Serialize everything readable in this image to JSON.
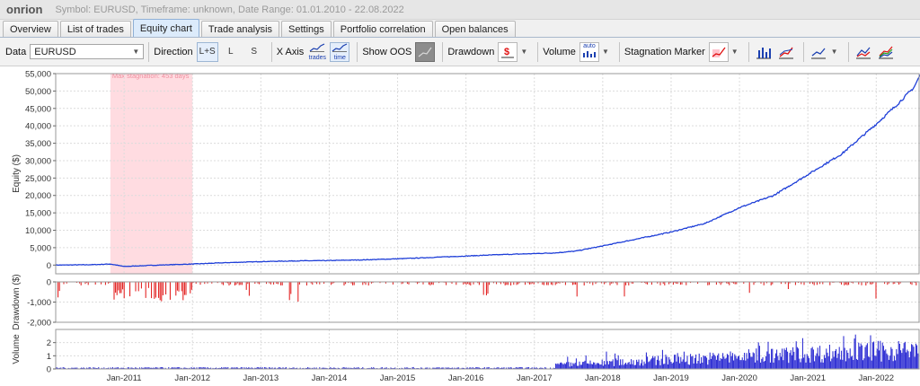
{
  "window": {
    "app_name": "onrion",
    "info": "Symbol: EURUSD, Timeframe: unknown, Date Range: 01.01.2010 - 22.08.2022"
  },
  "tabs": [
    "Overview",
    "List of trades",
    "Equity chart",
    "Trade analysis",
    "Settings",
    "Portfolio correlation",
    "Open balances"
  ],
  "active_tab": "Equity chart",
  "toolbar": {
    "data_label": "Data",
    "data_value": "EURUSD",
    "direction_label": "Direction",
    "direction_options": [
      "L+S",
      "L",
      "S"
    ],
    "direction_selected": "L+S",
    "xaxis_label": "X Axis",
    "xaxis_trades": "trades",
    "xaxis_time": "time",
    "show_oos_label": "Show OOS",
    "drawdown_label": "Drawdown",
    "volume_label": "Volume",
    "volume_icon_text": "auto",
    "stagnation_label": "Stagnation Marker",
    "colors": {
      "accent": "#1f3fd8",
      "drawdown": "#e01010",
      "stagnation": "#ffd6dc"
    }
  },
  "chart_data": {
    "equity": {
      "type": "line",
      "ylabel": "Equity ($)",
      "ylim": [
        -2500,
        55000
      ],
      "yticks": [
        0,
        5000,
        10000,
        15000,
        20000,
        25000,
        30000,
        35000,
        40000,
        45000,
        50000,
        55000
      ],
      "ytick_labels": [
        "0",
        "5,000",
        "10,000",
        "15,000",
        "20,000",
        "25,000",
        "30,000",
        "35,000",
        "40,000",
        "45,000",
        "50,000",
        "55,000"
      ],
      "x": [
        2010.0,
        2010.5,
        2010.8,
        2011.0,
        2011.5,
        2012.0,
        2012.5,
        2013.0,
        2013.5,
        2014.0,
        2014.5,
        2015.0,
        2015.5,
        2016.0,
        2016.5,
        2017.0,
        2017.3,
        2017.6,
        2018.0,
        2018.5,
        2019.0,
        2019.5,
        2020.0,
        2020.5,
        2021.0,
        2021.5,
        2022.0,
        2022.3,
        2022.55,
        2022.64
      ],
      "y": [
        0,
        100,
        300,
        -400,
        0,
        300,
        700,
        1000,
        1200,
        1300,
        1500,
        1800,
        2200,
        2600,
        3000,
        3300,
        3500,
        4000,
        5500,
        7500,
        9500,
        12000,
        16500,
        20000,
        26000,
        32000,
        40500,
        46000,
        51000,
        54500
      ],
      "stagnation": {
        "label": "Max stagnation: 453 days",
        "x_start": 2010.8,
        "x_end": 2012.0
      }
    },
    "drawdown": {
      "type": "bar",
      "ylabel": "Drawdown ($)",
      "ylim": [
        -2000,
        0
      ],
      "yticks": [
        0,
        -1000,
        -2000
      ],
      "ytick_labels": [
        "0",
        "-1,000",
        "-2,000"
      ],
      "color": "#e01010"
    },
    "volume": {
      "type": "bar",
      "ylabel": "Volume",
      "ylim": [
        0,
        3
      ],
      "yticks": [
        0,
        1,
        2
      ],
      "ytick_labels": [
        "0",
        "1",
        "2"
      ],
      "color": "#1f1fd0"
    },
    "xaxis": {
      "xlim": [
        2010.0,
        2022.64
      ],
      "ticks": [
        2011,
        2012,
        2013,
        2014,
        2015,
        2016,
        2017,
        2018,
        2019,
        2020,
        2021,
        2022
      ],
      "tick_labels": [
        "Jan-2011",
        "Jan-2012",
        "Jan-2013",
        "Jan-2014",
        "Jan-2015",
        "Jan-2016",
        "Jan-2017",
        "Jan-2018",
        "Jan-2019",
        "Jan-2020",
        "Jan-2021",
        "Jan-2022"
      ]
    },
    "grid": true
  }
}
